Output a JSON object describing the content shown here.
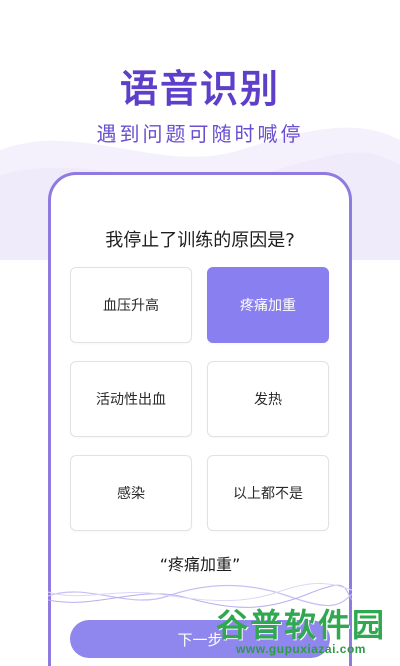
{
  "hero": {
    "title": "语音识别",
    "subtitle": "遇到问题可随时喊停"
  },
  "screen": {
    "question": "我停止了训练的原因是?",
    "options": [
      {
        "label": "血压升高",
        "selected": false
      },
      {
        "label": "疼痛加重",
        "selected": true
      },
      {
        "label": "活动性出血",
        "selected": false
      },
      {
        "label": "发热",
        "selected": false
      },
      {
        "label": "感染",
        "selected": false
      },
      {
        "label": "以上都不是",
        "selected": false
      }
    ],
    "recognized_answer": "“疼痛加重”",
    "next_button_label": "下一步"
  },
  "watermark": {
    "text_cn": "谷普软件园",
    "text_en": "www.gupuxiazai.com"
  },
  "colors": {
    "brand_purple": "#5d3fc9",
    "frame_purple": "#8f7ae0",
    "selected_option": "#8a7ff0",
    "button_purple": "#8f86ee",
    "watermark_green": "#2fa84f"
  }
}
